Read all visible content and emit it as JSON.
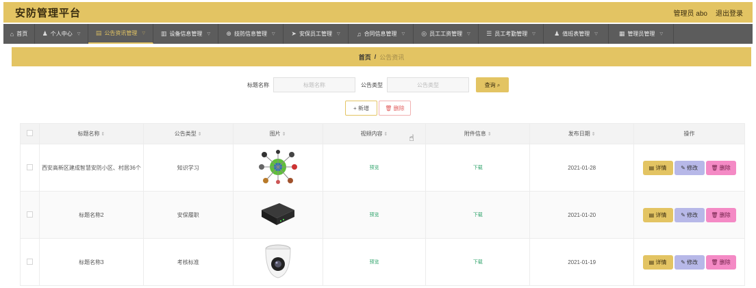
{
  "app": {
    "title": "安防管理平台",
    "user": "管理员 abo",
    "logout": "退出登录"
  },
  "nav": [
    {
      "icon": "home-icon",
      "glyph": "⌂",
      "label": "首页",
      "active": false,
      "caret": false
    },
    {
      "icon": "user-icon",
      "glyph": "♟",
      "label": "个人中心",
      "active": false,
      "caret": true
    },
    {
      "icon": "notice-icon",
      "glyph": "▤",
      "label": "公告资讯管理",
      "active": true,
      "caret": true
    },
    {
      "icon": "device-icon",
      "glyph": "▥",
      "label": "设备信息管理",
      "active": false,
      "caret": true
    },
    {
      "icon": "tech-icon",
      "glyph": "⊕",
      "label": "技防信息管理",
      "active": false,
      "caret": true
    },
    {
      "icon": "send-icon",
      "glyph": "➤",
      "label": "安保员工管理",
      "active": false,
      "caret": true
    },
    {
      "icon": "bell-icon",
      "glyph": "♫",
      "label": "合同信息管理",
      "active": false,
      "caret": true
    },
    {
      "icon": "salary-icon",
      "glyph": "◎",
      "label": "员工工资管理",
      "active": false,
      "caret": true
    },
    {
      "icon": "list-icon",
      "glyph": "☰",
      "label": "员工考勤管理",
      "active": false,
      "caret": true
    },
    {
      "icon": "person-icon",
      "glyph": "♟",
      "label": "值班表管理",
      "active": false,
      "caret": true
    },
    {
      "icon": "admin-icon",
      "glyph": "▦",
      "label": "管理员管理",
      "active": false,
      "caret": true
    }
  ],
  "breadcrumb": {
    "home": "首页",
    "sep": "/",
    "current": "公告资讯"
  },
  "search": {
    "title_label": "标题名称",
    "title_placeholder": "标题名称",
    "type_label": "公告类型",
    "type_placeholder": "公告类型",
    "query_label": "查询 ⌕"
  },
  "actions": {
    "add_label": "+ 新增",
    "delete_label": "🗑 删除"
  },
  "table": {
    "headers": [
      "标题名称",
      "公告类型",
      "图片",
      "视频内容",
      "附件信息",
      "发布日期",
      "操作"
    ],
    "rows": [
      {
        "title": "西安高新区建成智慧安防小区、村居36个",
        "type": "知识学习",
        "image": "network-diagram",
        "video": "预览",
        "attachment": "下载",
        "date": "2021-01-28"
      },
      {
        "title": "标题名称2",
        "type": "安保履职",
        "image": "dvr-box",
        "video": "预览",
        "attachment": "下载",
        "date": "2021-01-20"
      },
      {
        "title": "标题名称3",
        "type": "考核标准",
        "image": "dome-camera",
        "video": "预览",
        "attachment": "下载",
        "date": "2021-01-19"
      }
    ],
    "ops": {
      "detail": "▤ 详情",
      "edit": "✎ 修改",
      "delete": "🗑 删除"
    }
  }
}
